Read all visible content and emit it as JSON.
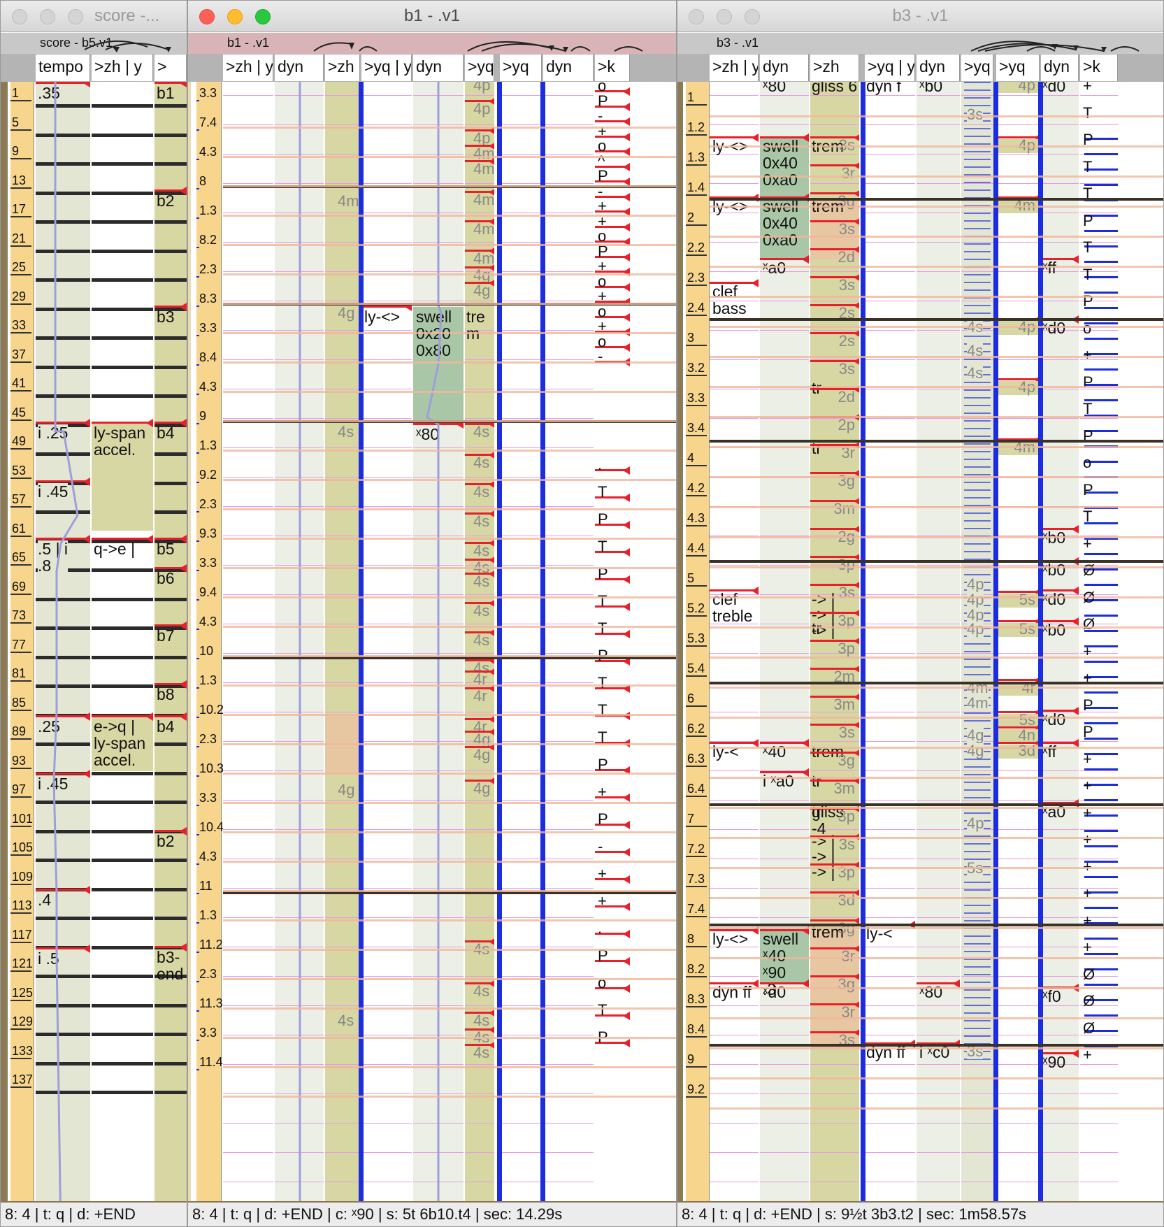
{
  "windows": {
    "score": {
      "title": "score -...",
      "seq_name": "score - b5.v1",
      "columns": [
        "tempo",
        ">zh | y",
        ">"
      ],
      "ruler": [
        "1",
        "5",
        "9",
        "13",
        "17",
        "21",
        "25",
        "29",
        "33",
        "37",
        "41",
        "45",
        "49",
        "53",
        "57",
        "61",
        "65",
        "69",
        "73",
        "77",
        "81",
        "85",
        "89",
        "93",
        "97",
        "101",
        "105",
        "109",
        "113",
        "117",
        "121",
        "125",
        "129",
        "133",
        "137"
      ],
      "tempo_events": [
        ".35",
        "i .25",
        "i .45",
        ".5 | i\n.8",
        ".25",
        "i .45",
        ".4",
        "i .5"
      ],
      "zh_events": [
        "ly-span\naccel.",
        "q->e |",
        "e->q |\nly-span\naccel."
      ],
      "block_events": [
        "b1",
        "b2",
        "b3",
        "b4",
        "b5",
        "b6",
        "b7",
        "b8",
        "b4",
        "b2",
        "b3-\nend"
      ],
      "status": "8: 4 | t: q | d: +END"
    },
    "b1": {
      "title": "b1 - .v1",
      "seq_name": "b1 - .v1",
      "columns": [
        ">zh | y",
        "dyn",
        ">zh",
        ">yq | y",
        "dyn",
        ">yq",
        ">yq",
        "dyn",
        ">k"
      ],
      "ruler": [
        "3.3",
        "7.4",
        "4.3",
        "8",
        "1.3",
        "8.2",
        "2.3",
        "8.3",
        "3.3",
        "8.4",
        "4.3",
        "9",
        "1.3",
        "9.2",
        "2.3",
        "9.3",
        "3.3",
        "9.4",
        "4.3",
        "10",
        "1.3",
        "10.2",
        "2.3",
        "10.3",
        "3.3",
        "10.4",
        "4.3",
        "11",
        "1.3",
        "11.2",
        "2.3",
        "11.3",
        "3.3",
        "11.4"
      ],
      "zh_grey": [
        "4m",
        "4g",
        "4s",
        "4r",
        "4g",
        "4s"
      ],
      "yqy_events": [
        "ly-<>"
      ],
      "dyn_events": [
        "swell\n0x20\n0x80",
        "80"
      ],
      "yq_events": [
        "tre\nm"
      ],
      "yq_grey": [
        "4p",
        "4p",
        "4p",
        "4m",
        "4m",
        "4m",
        "4m",
        "4m",
        "4g",
        "4g",
        "4s",
        "4s",
        "4s",
        "4s",
        "4s",
        "4s",
        "4s",
        "4s",
        "4s",
        "4s",
        "4r",
        "4r",
        "4r",
        "4g",
        "4g",
        "4g",
        "4s",
        "4s",
        "4s",
        "4s",
        "4s"
      ],
      "k_events": [
        "o",
        "P",
        "-",
        "+",
        "o",
        "^",
        "P",
        "-",
        "+",
        "+",
        "o",
        "P",
        "+",
        "o",
        "+",
        "o",
        "+",
        "o",
        "-",
        ".",
        "T",
        "P",
        "T",
        "P",
        "T",
        "T",
        "P",
        "T",
        "T",
        "T",
        "P",
        "+",
        "P",
        "-",
        "+",
        "+",
        ".",
        "P",
        "o",
        "T",
        "P",
        "T"
      ],
      "status": "8: 4 | t: q | d: +END | c: ˣ90 | s: 5t 6b10.t4 | sec: 14.29s"
    },
    "b3": {
      "title": "b3 - .v1",
      "seq_name": "b3 - .v1",
      "columns": [
        ">zh | y",
        "dyn",
        ">zh",
        ">yq | y",
        "dyn",
        ">yq",
        ">yq",
        "dyn",
        ">k"
      ],
      "ruler": [
        "1",
        "1.2",
        "1.3",
        "1.4",
        "2",
        "2.2",
        "2.3",
        "2.4",
        "3",
        "3.2",
        "3.3",
        "3.4",
        "4",
        "4.2",
        "4.3",
        "4.4",
        "5",
        "5.2",
        "5.3",
        "5.4",
        "6",
        "6.2",
        "6.3",
        "6.4",
        "7",
        "7.2",
        "7.3",
        "7.4",
        "8",
        "8.2",
        "8.3",
        "8.4",
        "9",
        "9.2"
      ],
      "zhy_events": [
        "ly-<>",
        "ly-<>",
        "clef\nbass",
        "clef\ntreble",
        "ly-<",
        "ly-<>",
        "dyn ff"
      ],
      "dyn_events": [
        "80",
        "swell\n0x40\n0xa0",
        "swell\n0x40\n0xa0",
        "a0",
        "40",
        "i ˣa0",
        "swell\nˣ40\nˣ90\n.3",
        "d0"
      ],
      "zh_events": [
        "gliss 6",
        "trem",
        "trem",
        "tr",
        "tr",
        "tr",
        "-> |",
        "-> |",
        "-> |",
        "tr",
        "trem",
        "tr",
        "gliss\n-4",
        "-> |",
        "-> |",
        "-> |",
        "trem"
      ],
      "zh_grey": [
        "3s",
        "3r",
        "3g",
        "3s",
        "2d",
        "3s",
        "2s",
        "2s",
        "3s",
        "2d",
        "2p",
        "3r",
        "3g",
        "3m",
        "2g",
        "3p",
        "3s",
        "3p",
        "3p",
        "2m",
        "3m",
        "3s",
        "3g",
        "3m",
        "3p",
        "3s",
        "3p",
        "3d",
        "3g",
        "3r",
        "3g",
        "3r",
        "3s"
      ],
      "yqy_events": [
        "dyn f",
        "ly-<",
        "dyn ff"
      ],
      "dyn2_events": [
        "b0",
        "80",
        "i ˣc0"
      ],
      "yq1_grey": [
        "3s",
        "4s",
        "4s",
        "4s",
        "4p",
        "4p",
        "4p",
        "4p",
        "4m",
        "4m",
        "4g",
        "4g",
        "4p",
        "5s",
        "3s"
      ],
      "yq2_grey": [
        "4p",
        "4p",
        "4m",
        "4p",
        "4p",
        "4m",
        "5s",
        "5s",
        "4r",
        "5s",
        "4n",
        "3d"
      ],
      "dyn3_events": [
        "d0",
        "ff",
        "d0",
        "b0",
        "b0",
        "d0",
        "b0",
        "d0",
        "ff",
        "a0",
        "f0",
        "90"
      ],
      "k_events": [
        "+",
        "T",
        "P",
        "T",
        "T",
        "P",
        "T",
        "T",
        "P",
        "o",
        "+",
        "P",
        "T",
        "P",
        "o",
        "P",
        "T",
        "+",
        "Ø",
        "Ø",
        "Ø",
        "+",
        "+",
        "P",
        "P",
        "+",
        "+",
        "+",
        "+",
        "+",
        "+",
        "+",
        "+",
        "Ø",
        "Ø",
        "Ø",
        "+"
      ],
      "status": "8: 4 | t: q | d: +END | s: 9½t 3b3.t2 | sec: 1m58.57s"
    }
  },
  "colors": {
    "ruler": "#f7d58d",
    "event_bg": "#e4e6d4",
    "block_bg": "#d7d7a3",
    "orange_block": "#e6c7a2",
    "green_block": "#a9c6a6",
    "separator": "#1b2dde",
    "red_marker": "#e8202a"
  }
}
